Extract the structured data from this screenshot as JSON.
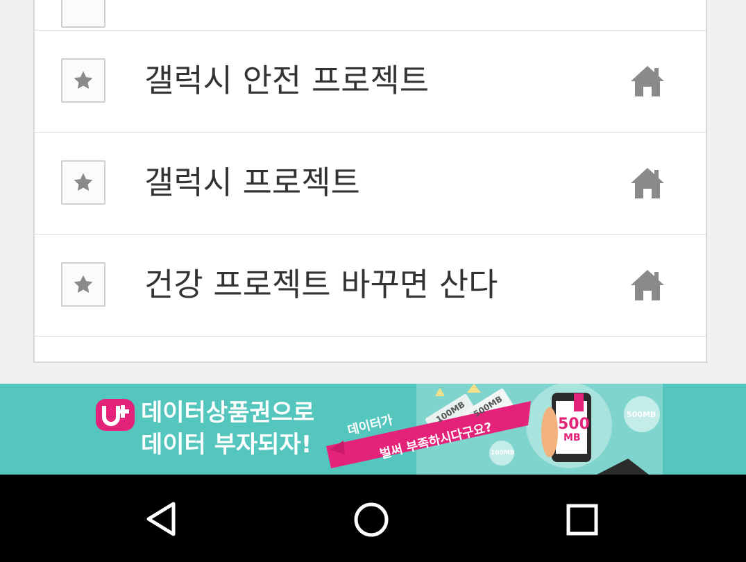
{
  "list": {
    "items": [
      {
        "title": "갤럭시 안전 프로젝트"
      },
      {
        "title": "갤럭시 프로젝트"
      },
      {
        "title": "건강 프로젝트 바꾸면 산다"
      }
    ]
  },
  "icons": {
    "favorite": "star-icon",
    "home": "home-icon"
  },
  "ad": {
    "line1": "데이터상품권으로",
    "line2": "데이터 부자되자!",
    "ribbon_line1": "데이터가",
    "ribbon_line2": "벌써 부족하시다구요?",
    "phone_amount": "500",
    "phone_unit": "MB",
    "bubble_500": "500MB",
    "bubble_100": "100MB",
    "ticket_1": "100MB",
    "ticket_2": "500MB",
    "brand_color": "#e5227a",
    "background_color": "#54c6bd"
  },
  "navigation": {
    "back": "back-icon",
    "home": "home-circle-icon",
    "recents": "recents-icon"
  }
}
